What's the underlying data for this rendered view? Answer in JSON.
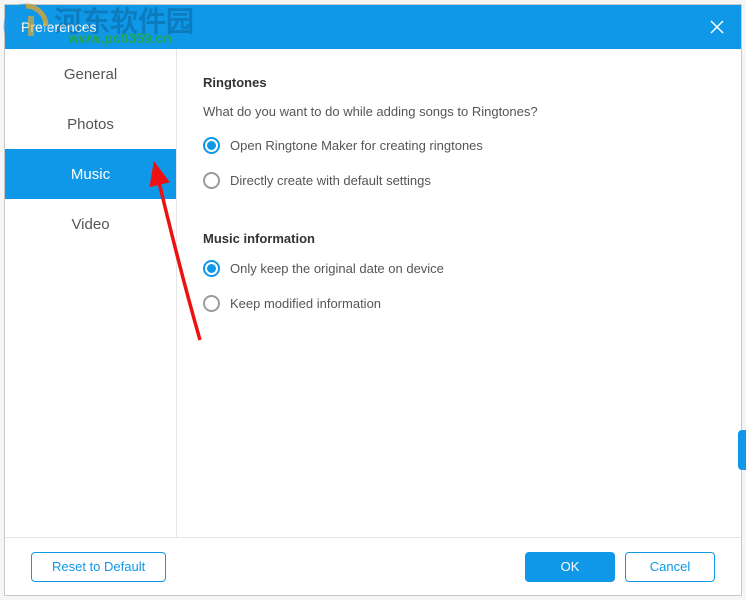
{
  "window": {
    "title": "Preferences"
  },
  "sidebar": {
    "tabs": [
      {
        "label": "General"
      },
      {
        "label": "Photos"
      },
      {
        "label": "Music"
      },
      {
        "label": "Video"
      }
    ]
  },
  "content": {
    "ringtones": {
      "title": "Ringtones",
      "question": "What do you want to do while adding songs to Ringtones?",
      "options": [
        {
          "label": "Open Ringtone Maker for creating ringtones"
        },
        {
          "label": "Directly create with default settings"
        }
      ]
    },
    "musicinfo": {
      "title": "Music information",
      "options": [
        {
          "label": "Only keep the original date on device"
        },
        {
          "label": "Keep modified information"
        }
      ]
    }
  },
  "footer": {
    "reset": "Reset to Default",
    "ok": "OK",
    "cancel": "Cancel"
  },
  "watermark": {
    "text1": "河东软件园",
    "text2": "www.pc0359.cn"
  }
}
